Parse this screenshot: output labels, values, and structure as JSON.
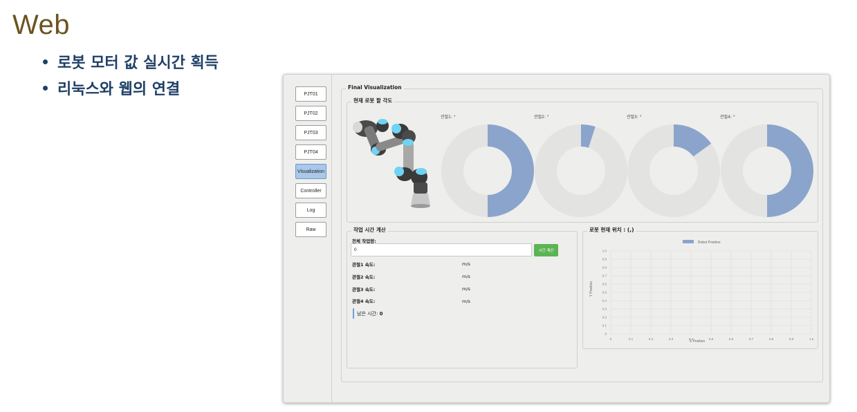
{
  "slide": {
    "title": "Web",
    "bullets": [
      "로봇 모터 값 실시간 획득",
      "리눅스와 웹의 연결"
    ]
  },
  "sidebar": {
    "items": [
      {
        "label": "PJT01",
        "active": false
      },
      {
        "label": "PJT02",
        "active": false
      },
      {
        "label": "PJT03",
        "active": false
      },
      {
        "label": "PJT04",
        "active": false
      },
      {
        "label": "Visualization",
        "active": true
      },
      {
        "label": "Controller",
        "active": false
      },
      {
        "label": "Log",
        "active": false
      },
      {
        "label": "Raw",
        "active": false
      }
    ]
  },
  "main": {
    "title": "Final Visualization",
    "arm_angle": {
      "title": "현재 로봇 팔 각도",
      "gauge_color": "#8ba4cc",
      "gauge_track_color": "#e3e3e1",
      "joints": [
        {
          "label": "관절1: °",
          "fraction": 0.5
        },
        {
          "label": "관절2: °",
          "fraction": 0.05
        },
        {
          "label": "관절3: °",
          "fraction": 0.15
        },
        {
          "label": "관절4: °",
          "fraction": 0.5
        }
      ]
    },
    "work_time": {
      "title": "작업 시간 계산",
      "total_label": "전체 작업량:",
      "total_value": "0",
      "calc_button": "시간 계산",
      "speed_rows": [
        {
          "label": "관절1 속도:",
          "unit": "m/s"
        },
        {
          "label": "관절2 속도:",
          "unit": "m/s"
        },
        {
          "label": "관절3 속도:",
          "unit": "m/s"
        },
        {
          "label": "관절4 속도:",
          "unit": "m/s"
        }
      ],
      "remaining_label": "남은 시간:",
      "remaining_value": "0"
    },
    "position": {
      "title": "로봇 현재 위치 : (,)"
    }
  },
  "chart_data": {
    "type": "scatter",
    "title": "",
    "xlabel": "X Position",
    "ylabel": "Y Position",
    "xlim": [
      0,
      1
    ],
    "ylim": [
      0,
      1
    ],
    "x_ticks": [
      "0",
      "0.1",
      "0.2",
      "0.3",
      "0.4",
      "0.5",
      "0.6",
      "0.7",
      "0.8",
      "0.9",
      "1.0"
    ],
    "y_ticks": [
      "0",
      "0.1",
      "0.2",
      "0.3",
      "0.4",
      "0.5",
      "0.6",
      "0.7",
      "0.8",
      "0.9",
      "1.0"
    ],
    "grid": true,
    "legend": "top",
    "series": [
      {
        "name": "Robot Position",
        "color": "#8ba4cc",
        "points": []
      }
    ]
  }
}
